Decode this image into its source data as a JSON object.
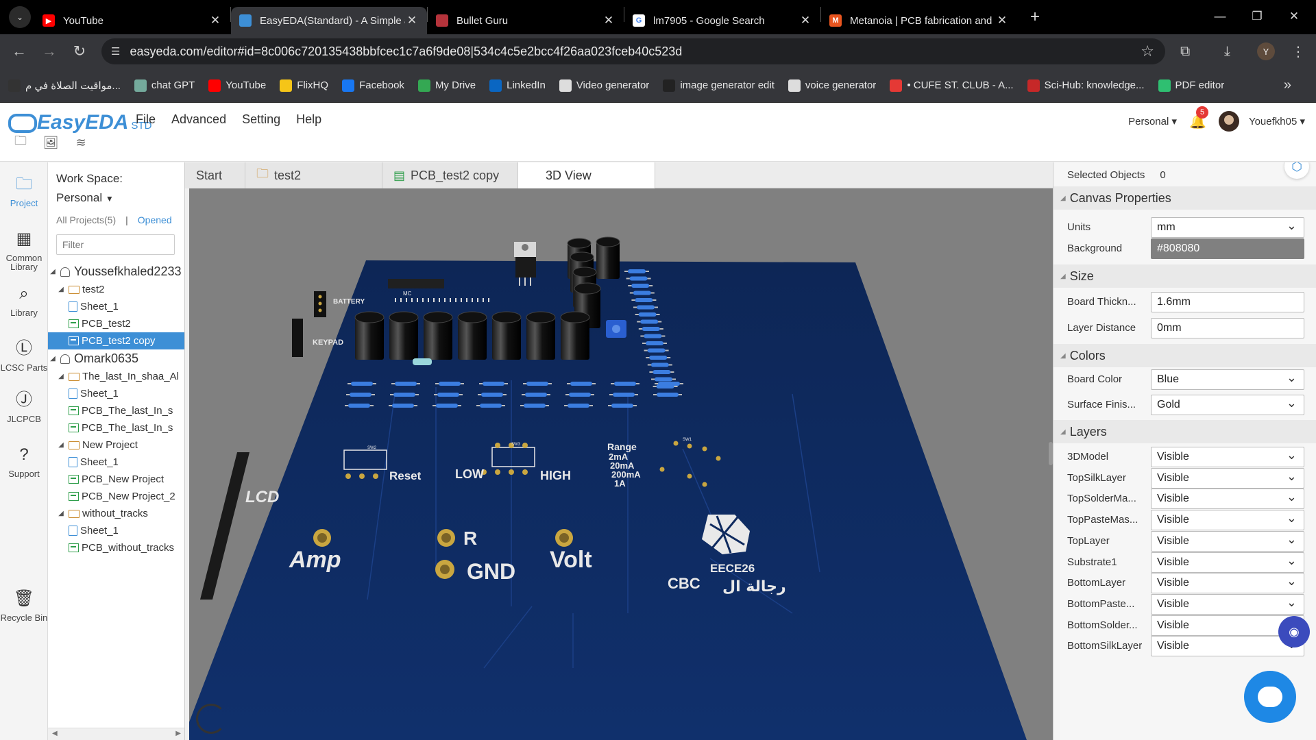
{
  "browser": {
    "tabs": [
      {
        "title": "YouTube",
        "icon": "youtube-icon",
        "color": "#ff0000",
        "active": false
      },
      {
        "title": "EasyEDA(Standard) - A Simple a",
        "icon": "easyeda-icon",
        "color": "#3d8fd6",
        "active": true
      },
      {
        "title": "Bullet Guru",
        "icon": "bullet-guru-icon",
        "color": "#b5333b",
        "active": false
      },
      {
        "title": "lm7905 - Google Search",
        "icon": "google-icon",
        "color": "#ffffff",
        "active": false
      },
      {
        "title": "Metanoia | PCB fabrication and",
        "icon": "metanoia-icon",
        "color": "#e8551f",
        "active": false
      }
    ],
    "url": "easyeda.com/editor#id=8c006c720135438bbfcec1c7a6f9de08|534c4c5e2bcc4f26aa023fceb40c523d",
    "profile_initial": "Y",
    "bookmarks": [
      {
        "label": "مواقيت الصلاة في م...",
        "icon": "mosque-icon",
        "color": "#333333"
      },
      {
        "label": "chat GPT",
        "icon": "chatgpt-icon",
        "color": "#74aa9c"
      },
      {
        "label": "YouTube",
        "icon": "youtube-icon",
        "color": "#ff0000"
      },
      {
        "label": "FlixHQ",
        "icon": "flixhq-icon",
        "color": "#f5c518"
      },
      {
        "label": "Facebook",
        "icon": "facebook-icon",
        "color": "#1877f2"
      },
      {
        "label": "My Drive",
        "icon": "drive-icon",
        "color": "#34a853"
      },
      {
        "label": "LinkedIn",
        "icon": "linkedin-icon",
        "color": "#0a66c2"
      },
      {
        "label": "Video generator",
        "icon": "video-generator-icon",
        "color": "#dddddd"
      },
      {
        "label": "image generator edit",
        "icon": "image-generator-icon",
        "color": "#222222"
      },
      {
        "label": "voice generator",
        "icon": "voice-generator-icon",
        "color": "#dddddd"
      },
      {
        "label": "• CUFE ST. CLUB - A...",
        "icon": "cufe-club-icon",
        "color": "#e53935"
      },
      {
        "label": "Sci-Hub: knowledge...",
        "icon": "scihub-icon",
        "color": "#c62828"
      },
      {
        "label": "PDF editor",
        "icon": "pdf-editor-icon",
        "color": "#2fbf71"
      }
    ]
  },
  "app": {
    "brand": "EasyEDA",
    "brand_suffix": "STD",
    "menu": [
      "File",
      "Advanced",
      "Setting",
      "Help"
    ],
    "workspace_switch": "Personal",
    "notification_count": "5",
    "username": "Youefkh05"
  },
  "leftbar": [
    {
      "label": "Project",
      "icon": "folder-icon",
      "active": true
    },
    {
      "label": "Common Library",
      "icon": "chip-icon",
      "active": false
    },
    {
      "label": "Library",
      "icon": "library-search-icon",
      "active": false
    },
    {
      "label": "LCSC Parts",
      "icon": "lcsc-icon",
      "active": false
    },
    {
      "label": "JLCPCB",
      "icon": "jlcpcb-icon",
      "active": false
    },
    {
      "label": "Support",
      "icon": "help-icon",
      "active": false
    },
    {
      "label": "Recycle Bin",
      "icon": "trash-icon",
      "active": false
    }
  ],
  "project_panel": {
    "workspace_label": "Work Space:",
    "workspace_value": "Personal",
    "all_projects": "All Projects(5)",
    "opened": "Opened",
    "filter_placeholder": "Filter",
    "tree": [
      {
        "label": "Youssefkhaled2233",
        "type": "user",
        "level": 0
      },
      {
        "label": "test2",
        "type": "folder",
        "level": 1
      },
      {
        "label": "Sheet_1",
        "type": "sheet",
        "level": 2
      },
      {
        "label": "PCB_test2",
        "type": "pcb",
        "level": 2
      },
      {
        "label": "PCB_test2 copy",
        "type": "pcb",
        "level": 2,
        "selected": true
      },
      {
        "label": "Omark0635",
        "type": "user",
        "level": 0
      },
      {
        "label": "The_last_In_shaa_Al",
        "type": "folder",
        "level": 1
      },
      {
        "label": "Sheet_1",
        "type": "sheet",
        "level": 2
      },
      {
        "label": "PCB_The_last_In_s",
        "type": "pcb",
        "level": 2
      },
      {
        "label": "PCB_The_last_In_s",
        "type": "pcb",
        "level": 2
      },
      {
        "label": "New Project",
        "type": "folder",
        "level": 1
      },
      {
        "label": "Sheet_1",
        "type": "sheet",
        "level": 2
      },
      {
        "label": "PCB_New Project",
        "type": "pcb",
        "level": 2
      },
      {
        "label": "PCB_New Project_2",
        "type": "pcb",
        "level": 2
      },
      {
        "label": "without_tracks",
        "type": "folder",
        "level": 1
      },
      {
        "label": "Sheet_1",
        "type": "sheet",
        "level": 2
      },
      {
        "label": "PCB_without_tracks",
        "type": "pcb",
        "level": 2
      }
    ]
  },
  "doc_tabs": [
    {
      "label": "Start",
      "icon": "",
      "active": false
    },
    {
      "label": "test2",
      "icon": "folder-icon",
      "active": false
    },
    {
      "label": "PCB_test2 copy",
      "icon": "pcb-icon",
      "active": false
    },
    {
      "label": "3D View",
      "icon": "",
      "active": true
    }
  ],
  "pcb_silkscreen": {
    "battery": "BATTERY",
    "keypad": "KEYPAD",
    "mc": "MC",
    "lcd": "LCD",
    "reset": "Reset",
    "sw2": "SW2",
    "sw3": "SW3",
    "sw1": "SW1",
    "low": "LOW",
    "high": "HIGH",
    "range_title": "Range",
    "range_values": [
      "2mA",
      "20mA",
      "200mA",
      "1A"
    ],
    "amp": "Amp",
    "r": "R",
    "gnd": "GND",
    "volt": "Volt",
    "course": "EECE26",
    "cbc": "CBC",
    "arabic": "رجالة ال"
  },
  "canvas": {
    "background": "#808080",
    "board_color": "#0f2a5e"
  },
  "properties": {
    "selected_objects_label": "Selected Objects",
    "selected_objects_value": "0",
    "canvas_section": "Canvas Properties",
    "units_label": "Units",
    "units_value": "mm",
    "background_label": "Background",
    "background_value": "#808080",
    "size_section": "Size",
    "board_thickness_label": "Board Thickn...",
    "board_thickness_value": "1.6mm",
    "layer_distance_label": "Layer Distance",
    "layer_distance_value": "0mm",
    "colors_section": "Colors",
    "board_color_label": "Board Color",
    "board_color_value": "Blue",
    "surface_finish_label": "Surface Finis...",
    "surface_finish_value": "Gold",
    "layers_section": "Layers",
    "layers": [
      {
        "name": "3DModel",
        "value": "Visible"
      },
      {
        "name": "TopSilkLayer",
        "value": "Visible"
      },
      {
        "name": "TopSolderMa...",
        "value": "Visible"
      },
      {
        "name": "TopPasteMas...",
        "value": "Visible"
      },
      {
        "name": "TopLayer",
        "value": "Visible"
      },
      {
        "name": "Substrate1",
        "value": "Visible"
      },
      {
        "name": "BottomLayer",
        "value": "Visible"
      },
      {
        "name": "BottomPaste...",
        "value": "Visible"
      },
      {
        "name": "BottomSolder...",
        "value": "Visible"
      },
      {
        "name": "BottomSilkLayer",
        "value": "Visible"
      }
    ]
  }
}
